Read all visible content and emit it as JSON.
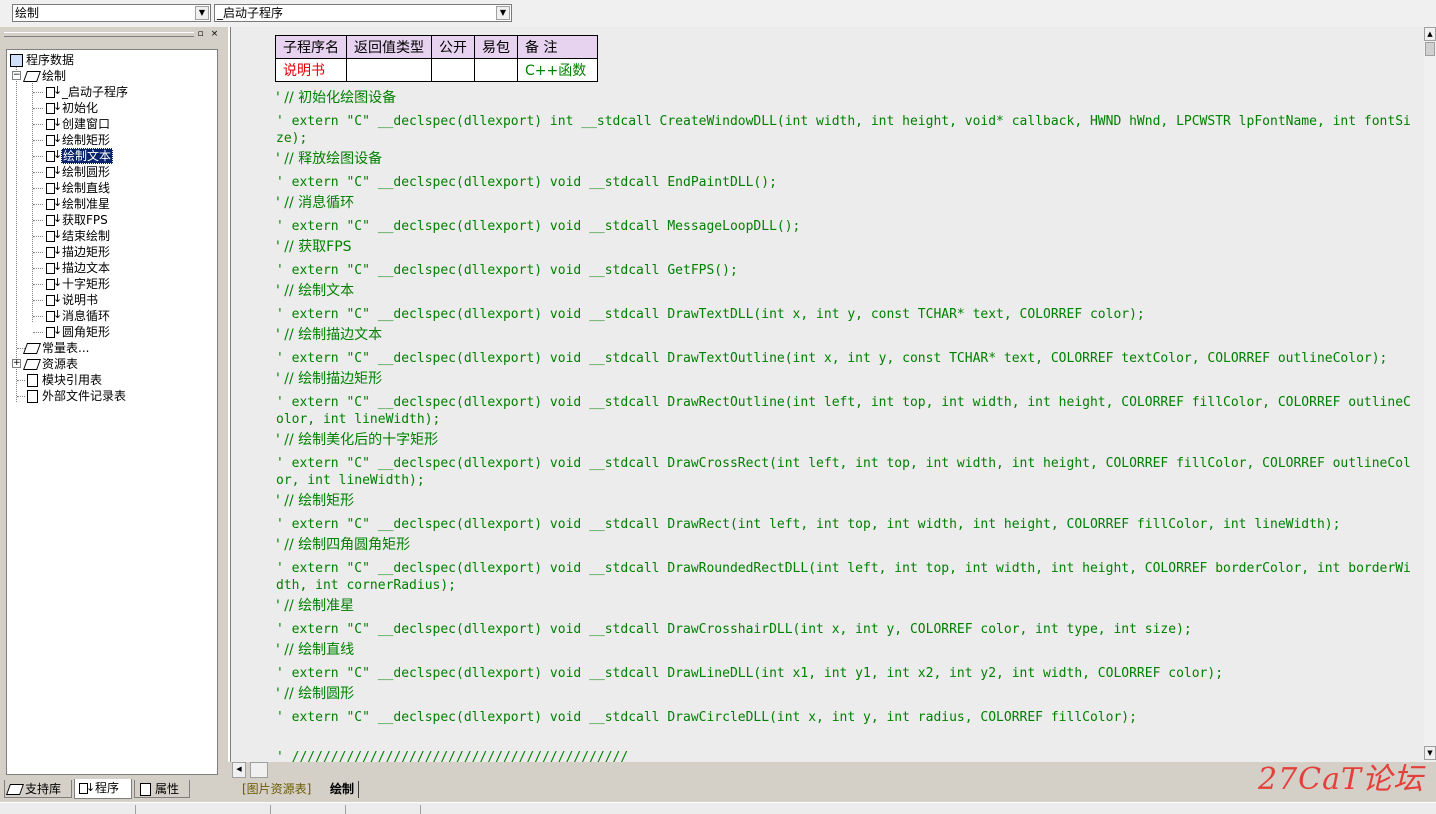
{
  "toolbar": {
    "combo_left_value": "绘制",
    "combo_right_value": "_启动子程序"
  },
  "tree": {
    "root_label": "程序数据",
    "group_label": "绘制",
    "items": [
      "_启动子程序",
      "初始化",
      "创建窗口",
      "绘制矩形",
      "绘制文本",
      "绘制圆形",
      "绘制直线",
      "绘制准星",
      "获取FPS",
      "结束绘制",
      "描边矩形",
      "描边文本",
      "十字矩形",
      "说明书",
      "消息循环",
      "圆角矩形"
    ],
    "selected_item": "绘制文本",
    "other_nodes": [
      "常量表...",
      "资源表",
      "模块引用表",
      "外部文件记录表"
    ]
  },
  "left_tabs": [
    "支持库",
    "程序",
    "属性"
  ],
  "sub_table": {
    "headers": [
      "子程序名",
      "返回值类型",
      "公开",
      "易包",
      "备 注"
    ],
    "row": [
      "说明书",
      "",
      "",
      "",
      "C++函数"
    ]
  },
  "code_lines": [
    "' // 初始化绘图设备",
    "' extern \"C\" __declspec(dllexport) int __stdcall CreateWindowDLL(int width, int height, void* callback, HWND hWnd, LPCWSTR lpFontName, int fontSize);",
    "' // 释放绘图设备",
    "' extern \"C\" __declspec(dllexport) void __stdcall EndPaintDLL();",
    "' // 消息循环",
    "' extern \"C\" __declspec(dllexport) void __stdcall MessageLoopDLL();",
    "' // 获取FPS",
    "' extern \"C\" __declspec(dllexport) void __stdcall GetFPS();",
    "' // 绘制文本",
    "' extern \"C\" __declspec(dllexport) void __stdcall DrawTextDLL(int x, int y, const TCHAR* text, COLORREF color);",
    "' // 绘制描边文本",
    "' extern \"C\" __declspec(dllexport) void __stdcall DrawTextOutline(int x, int y, const TCHAR* text, COLORREF textColor, COLORREF outlineColor);",
    "' // 绘制描边矩形",
    "' extern \"C\" __declspec(dllexport) void __stdcall DrawRectOutline(int left, int top, int width, int height, COLORREF fillColor, COLORREF outlineColor, int lineWidth);",
    "' // 绘制美化后的十字矩形",
    "' extern \"C\" __declspec(dllexport) void __stdcall DrawCrossRect(int left, int top, int width, int height, COLORREF fillColor, COLORREF outlineColor, int lineWidth);",
    "' // 绘制矩形",
    "' extern \"C\" __declspec(dllexport) void __stdcall DrawRect(int left, int top, int width, int height, COLORREF fillColor, int lineWidth);",
    "' // 绘制四角圆角矩形",
    "' extern \"C\" __declspec(dllexport) void __stdcall DrawRoundedRectDLL(int left, int top, int width, int height, COLORREF borderColor, int borderWidth, int cornerRadius);",
    "' // 绘制准星",
    "' extern \"C\" __declspec(dllexport) void __stdcall DrawCrosshairDLL(int x, int y, COLORREF color, int type, int size);",
    "' // 绘制直线",
    "' extern \"C\" __declspec(dllexport) void __stdcall DrawLineDLL(int x1, int y1, int x2, int y2, int width, COLORREF color);",
    "' // 绘制圆形",
    "' extern \"C\" __declspec(dllexport) void __stdcall DrawCircleDLL(int x, int y, int radius, COLORREF fillColor);",
    "' ///////////////////////////////////////////"
  ],
  "bottom_tabs": [
    "[图片资源表]",
    "绘制"
  ],
  "watermark": "27CaT论坛",
  "colors": {
    "code_green": "#008000",
    "subname_red": "#e00000",
    "header_purple": "#e7d3f0",
    "selection_blue": "#0a246a"
  }
}
